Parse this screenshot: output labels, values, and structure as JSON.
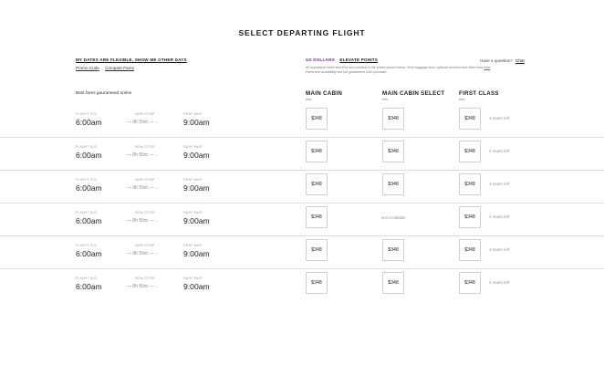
{
  "page_title": "SELECT DEPARTING FLIGHT",
  "flexible_dates": "MY DATES ARE FLEXIBLE, SHOW ME OTHER DAYS",
  "links": [
    "Promo Code",
    "Compare Fares"
  ],
  "currency": "US DOLLARS",
  "elevate": "ELEVATE POINTS",
  "disclaimer_line1": "All mandatory taxes and fees are included in the prices shown below. View baggage fees, optional services and other fees",
  "disclaimer_link": "here",
  "disclaimer_line2": "Fares and availability are not guaranteed until purchase.",
  "question": "Have a question?",
  "chat": "Chat",
  "best_fares": "Best fares gauranteed online",
  "cabins": [
    {
      "name": "MAIN CABIN",
      "info": "Info"
    },
    {
      "name": "MAIN CABIN SELECT",
      "info": "Info"
    },
    {
      "name": "FIRST CLASS",
      "info": "Info"
    }
  ],
  "flights": [
    {
      "flight": "FLIGHT 923",
      "depart": "6:00am",
      "stops": "NON-STOP",
      "duration": "6h 55m",
      "seat_map": "SEAT MAP",
      "arrive": "9:00am",
      "main": "$348",
      "select": "$348",
      "select_available": true,
      "first": "$348",
      "seats_left": "4 seats left"
    },
    {
      "flight": "FLIGHT 923",
      "depart": "6:00am",
      "stops": "NON-STOP",
      "duration": "6h 55m",
      "seat_map": "SEAT MAP",
      "arrive": "9:00am",
      "main": "$348",
      "select": "$348",
      "select_available": true,
      "first": "$348",
      "seats_left": "4 seats left"
    },
    {
      "flight": "FLIGHT 923",
      "depart": "6:00am",
      "stops": "NON-STOP",
      "duration": "6h 55m",
      "seat_map": "SEAT MAP",
      "arrive": "9:00am",
      "main": "$348",
      "select": "$348",
      "select_available": true,
      "first": "$348",
      "seats_left": "4 seats left"
    },
    {
      "flight": "FLIGHT 923",
      "depart": "6:00am",
      "stops": "NON-STOP",
      "duration": "6h 55m",
      "seat_map": "SEAT MAP",
      "arrive": "9:00am",
      "main": "$348",
      "select": "Not Available",
      "select_available": false,
      "first": "$348",
      "seats_left": "4 seats left"
    },
    {
      "flight": "FLIGHT 923",
      "depart": "6:00am",
      "stops": "NON-STOP",
      "duration": "6h 55m",
      "seat_map": "SEAT MAP",
      "arrive": "9:00am",
      "main": "$348",
      "select": "$348",
      "select_available": true,
      "first": "$348",
      "seats_left": "4 seats left"
    },
    {
      "flight": "FLIGHT 923",
      "depart": "6:00am",
      "stops": "NON-STOP",
      "duration": "6h 55m",
      "seat_map": "SEAT MAP",
      "arrive": "9:00am",
      "main": "$348",
      "select": "$348",
      "select_available": true,
      "first": "$348",
      "seats_left": "4 seats left"
    }
  ]
}
